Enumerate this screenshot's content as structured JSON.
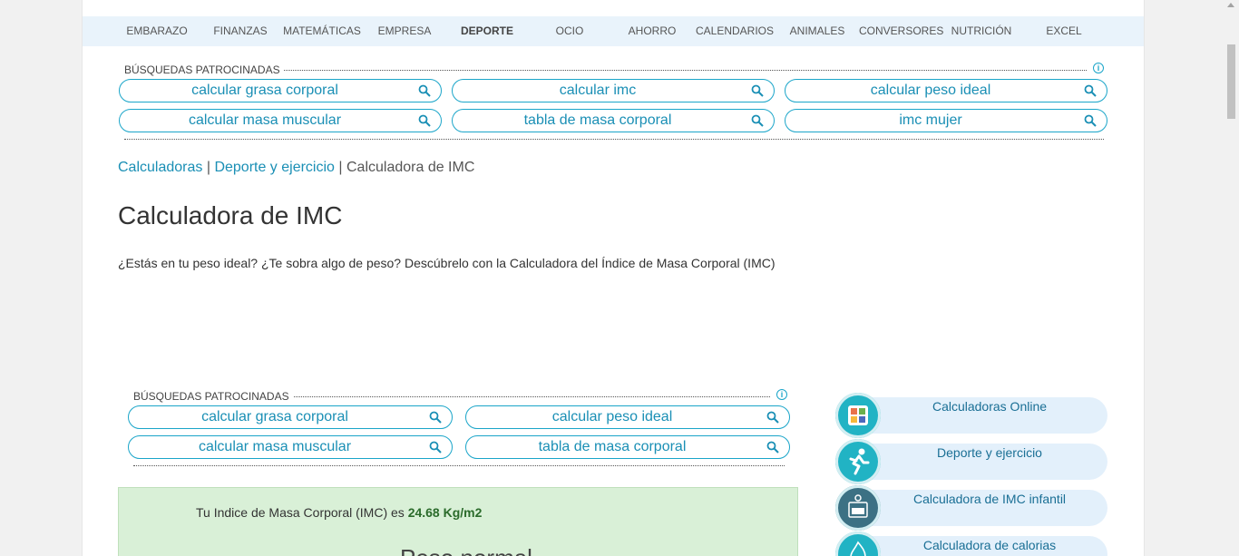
{
  "nav": {
    "items": [
      "EMBARAZO",
      "FINANZAS",
      "MATEMÁTICAS",
      "EMPRESA",
      "DEPORTE",
      "OCIO",
      "AHORRO",
      "CALENDARIOS",
      "ANIMALES",
      "CONVERSORES",
      "NUTRICIÓN",
      "EXCEL"
    ],
    "active": "DEPORTE"
  },
  "sponsored_top": {
    "title": "BÚSQUEDAS PATROCINADAS",
    "buttons": [
      "calcular grasa corporal",
      "calcular imc",
      "calcular peso ideal",
      "calcular masa muscular",
      "tabla de masa corporal",
      "imc mujer"
    ]
  },
  "breadcrumb": {
    "items": [
      "Calculadoras",
      "Deporte y ejercicio"
    ],
    "separator": " | ",
    "current": "Calculadora de IMC"
  },
  "page_title": "Calculadora de IMC",
  "intro": "¿Estás en tu peso ideal? ¿Te sobra algo de peso? Descúbrelo con la Calculadora del Índice de Masa Corporal (IMC)",
  "sponsored_mid": {
    "title": "BÚSQUEDAS PATROCINADAS",
    "buttons": [
      "calcular grasa corporal",
      "calcular peso ideal",
      "calcular masa muscular",
      "tabla de masa corporal"
    ]
  },
  "result": {
    "prefix": "Tu Indice de Masa Corporal (IMC) es ",
    "value": "24.68 Kg/m2",
    "partial_heading": "Peso normal"
  },
  "sidebar": {
    "items": [
      {
        "label": "Calculadoras Online",
        "icon": "calculator-icon"
      },
      {
        "label": "Deporte y ejercicio",
        "icon": "runner-icon"
      },
      {
        "label": "Calculadora de IMC infantil",
        "icon": "child-scale-icon"
      },
      {
        "label": "Calculadora de calorias",
        "icon": "flame-icon"
      }
    ]
  },
  "colors": {
    "accent": "#1aa5c9",
    "link": "#1a8fb5",
    "nav_bg": "#e9f3fb",
    "result_bg": "#d9f0d7",
    "side_pill_bg": "#e3f0fb",
    "icon_teal": "#21b3c4"
  }
}
